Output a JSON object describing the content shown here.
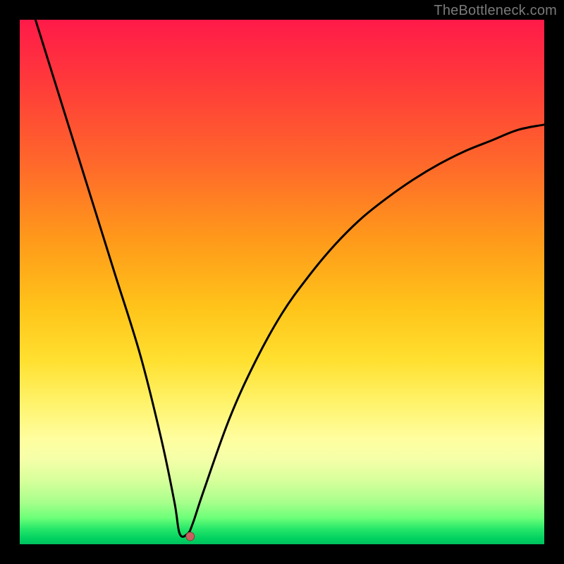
{
  "watermark": "TheBottleneck.com",
  "colors": {
    "frame_bg": "#000000",
    "curve_stroke": "#000000",
    "marker_fill": "#c86060",
    "marker_stroke": "#8a3a3a"
  },
  "chart_data": {
    "type": "line",
    "title": "",
    "xlabel": "",
    "ylabel": "",
    "xlim": [
      0,
      100
    ],
    "ylim": [
      0,
      100
    ],
    "grid": false,
    "series": [
      {
        "name": "bottleneck-curve",
        "x": [
          3,
          8,
          13,
          18,
          23,
          27,
          29.5,
          30.5,
          32,
          33,
          35,
          40,
          45,
          50,
          55,
          60,
          65,
          70,
          75,
          80,
          85,
          90,
          95,
          100
        ],
        "y": [
          100,
          84,
          68,
          52,
          36,
          20,
          8,
          2,
          2,
          4,
          10,
          24,
          35,
          44,
          51,
          57,
          62,
          66,
          69.5,
          72.5,
          75,
          77,
          79,
          80
        ]
      }
    ],
    "annotations": [
      {
        "name": "optimum-marker",
        "x": 32.5,
        "y": 1.5
      }
    ],
    "legend": false,
    "gradient_bands": [
      {
        "y": 0,
        "color": "#ff1a49"
      },
      {
        "y": 50,
        "color": "#ffc41a"
      },
      {
        "y": 80,
        "color": "#fffea0"
      },
      {
        "y": 100,
        "color": "#00c060"
      }
    ]
  }
}
